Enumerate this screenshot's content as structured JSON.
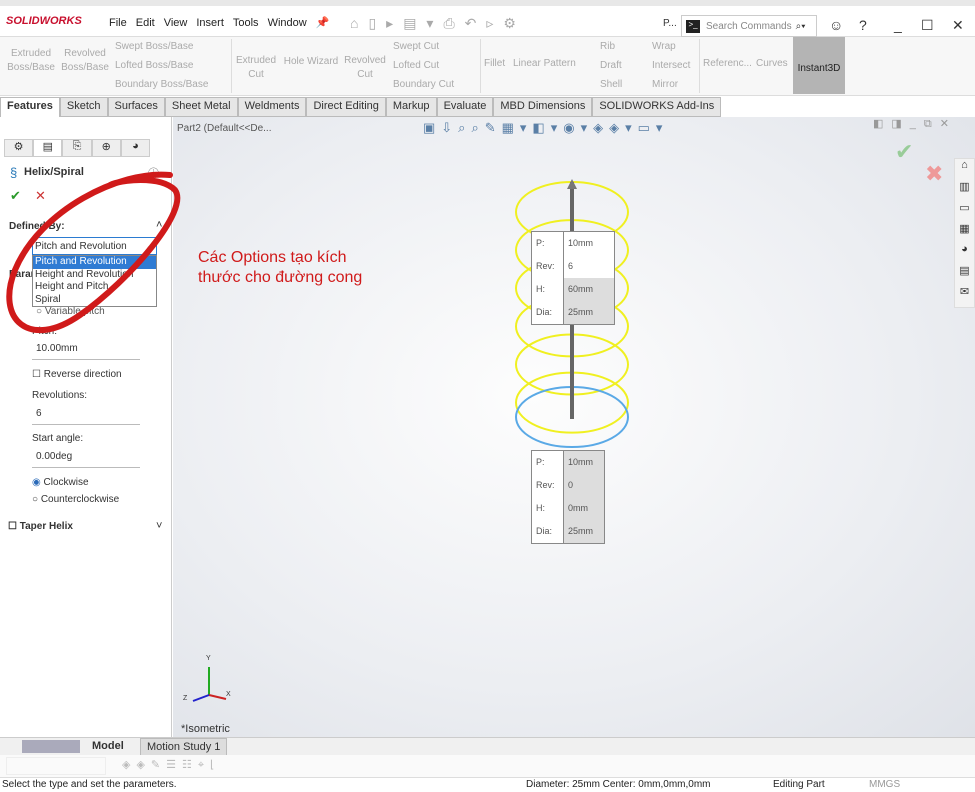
{
  "app": {
    "logo": "SOLIDWORKS",
    "menu": [
      "File",
      "Edit",
      "View",
      "Insert",
      "Tools",
      "Window"
    ],
    "doc_short": "P...",
    "search_placeholder": "Search Commands"
  },
  "ribbon": {
    "large": [
      "Extruded Boss/Base",
      "Revolved Boss/Base",
      "Extruded Cut",
      "Hole Wizard",
      "Revolved Cut",
      "Fillet",
      "Linear Pattern",
      "Referenc...",
      "Curves",
      "Instant3D"
    ],
    "small": [
      "Swept Boss/Base",
      "Lofted Boss/Base",
      "Boundary Boss/Base",
      "Swept Cut",
      "Lofted Cut",
      "Boundary Cut",
      "Rib",
      "Draft",
      "Shell",
      "Wrap",
      "Intersect",
      "Mirror"
    ]
  },
  "tabs": [
    "Features",
    "Sketch",
    "Surfaces",
    "Sheet Metal",
    "Weldments",
    "Direct Editing",
    "Markup",
    "Evaluate",
    "MBD Dimensions",
    "SOLIDWORKS Add-Ins"
  ],
  "panel": {
    "title": "Helix/Spiral",
    "ok": "✔",
    "cancel": "✕",
    "defined_by_label": "Defined By:",
    "defined_by_value": "Pitch and Revolution",
    "options": [
      "Pitch and Revolution",
      "Height and Revolution",
      "Height and Pitch",
      "Spiral"
    ],
    "params_label": "Param",
    "variable_pitch": "Variable pitch",
    "pitch_label": "Pitch:",
    "pitch_value": "10.00mm",
    "reverse_direction": "Reverse direction",
    "revolutions_label": "Revolutions:",
    "revolutions_value": "6",
    "start_angle_label": "Start angle:",
    "start_angle_value": "0.00deg",
    "clockwise": "Clockwise",
    "counterclockwise": "Counterclockwise",
    "direction_selected": "Clockwise",
    "taper_helix": "Taper Helix"
  },
  "viewport": {
    "tree_item": "Part2  (Default<<De...",
    "view_label": "*Isometric",
    "callout_top": {
      "rows": [
        [
          "P:",
          "10mm"
        ],
        [
          "Rev:",
          "6"
        ],
        [
          "H:",
          "60mm"
        ],
        [
          "Dia:",
          "25mm"
        ]
      ]
    },
    "callout_bottom": {
      "rows": [
        [
          "P:",
          "10mm"
        ],
        [
          "Rev:",
          "0"
        ],
        [
          "H:",
          "0mm"
        ],
        [
          "Dia:",
          "25mm"
        ]
      ]
    },
    "annotation_line1": "Các Options tạo kích",
    "annotation_line2": "thước cho đường cong",
    "axis_labels": [
      "Y",
      "X",
      "Z"
    ]
  },
  "bottom": {
    "tabs": [
      "Model",
      "Motion Study 1"
    ]
  },
  "status": {
    "message": "Select the type and set the parameters.",
    "geometry": "Diameter: 25mm  Center: 0mm,0mm,0mm",
    "mode": "Editing Part",
    "units": "MMGS"
  },
  "colors": {
    "helix": "#f0f020",
    "selected": "#5aa9e6",
    "annotation": "#d01a1a",
    "accent": "#2f7bd3"
  }
}
